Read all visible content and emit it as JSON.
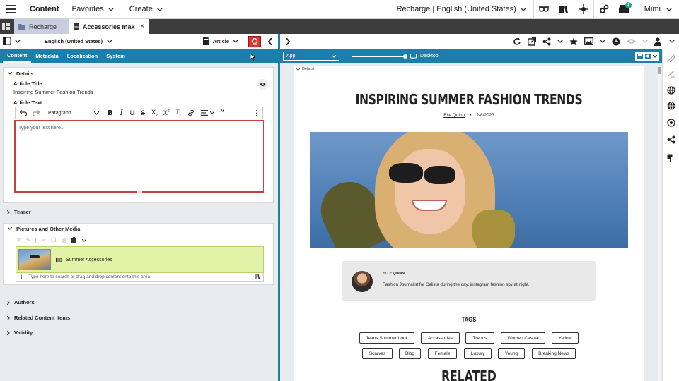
{
  "topbar": {
    "brand": "Content",
    "favorites": "Favorites",
    "create": "Create",
    "site": "Recharge | English (United States)",
    "user": "Mimi",
    "notification_count": "1"
  },
  "doc_tabs": {
    "tab1": "Recharge",
    "tab2": "Accessories make the di..."
  },
  "left_toolbar": {
    "language": "English (United States)",
    "doc_type": "Article"
  },
  "content_tabs": [
    "Content",
    "Metadata",
    "Localization",
    "System"
  ],
  "details": {
    "section": "Details",
    "title_label": "Article Title",
    "title_value": "Inspiring Summer Fashion Trends",
    "text_label": "Article Text",
    "paragraph": "Paragraph",
    "placeholder": "Type your text here..."
  },
  "sections": {
    "teaser": "Teaser",
    "pictures": "Pictures and Other Media",
    "media_item": "Summer Accessories",
    "drop_placeholder": "Type here to search or drag and drop content onto this area.",
    "authors": "Authors",
    "related": "Related Content Items",
    "validity": "Validity"
  },
  "preview_bar": {
    "select_value": "App",
    "device": "Desktop"
  },
  "preview": {
    "default_label": "Default",
    "title": "INSPIRING SUMMER FASHION TRENDS",
    "author_link": "Elle Quinn",
    "date": "2/8/2023",
    "author_name": "ELLE QUINN",
    "author_bio": "Fashion Journalist for Calista during the day, instagram fashion spy at night.",
    "tags_heading": "TAGS",
    "tags_row1": [
      "Jeans Summer Look",
      "Accessories",
      "Trends",
      "Women Casual",
      "Yellow"
    ],
    "tags_row2": [
      "Scarves",
      "Blog",
      "Female",
      "Luxury",
      "Young",
      "Breaking News"
    ],
    "related_heading": "RELATED"
  },
  "colors": {
    "accent": "#1c7eaa",
    "tab_active": "#c8cde0",
    "media_highlight": "#e2f2a6",
    "error_border": "#c94040"
  }
}
